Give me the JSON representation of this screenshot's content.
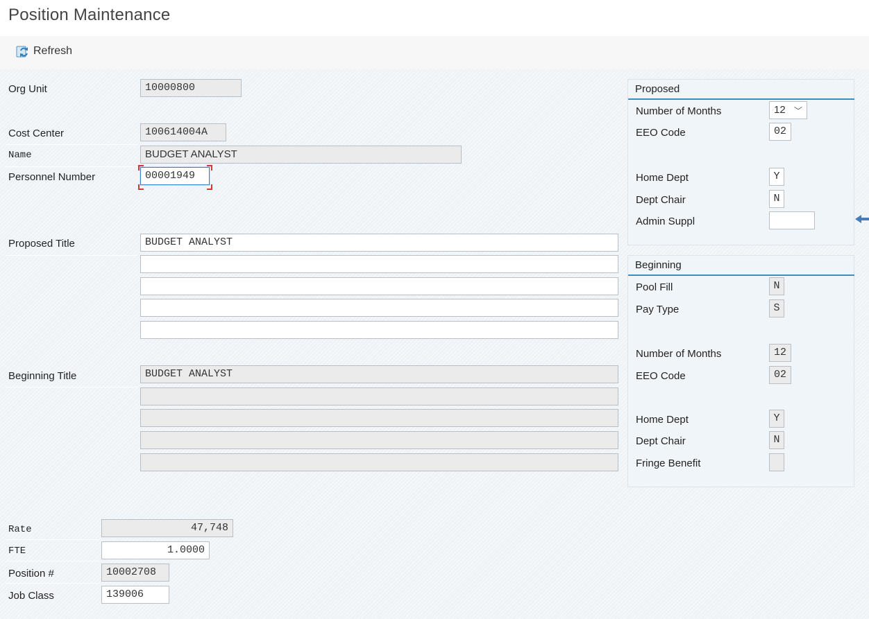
{
  "app": {
    "title": "Position Maintenance"
  },
  "toolbar": {
    "refresh_label": "Refresh",
    "refresh_icon": "refresh-icon"
  },
  "left": {
    "org_unit_label": "Org Unit",
    "org_unit_value": "10000800",
    "cost_center_label": "Cost Center",
    "cost_center_value": "100614004A",
    "name_label": "Name",
    "name_value": "BUDGET ANALYST",
    "personnel_label": "Personnel Number",
    "personnel_value": "00001949",
    "proposed_title_label": "Proposed Title",
    "proposed_title_lines": [
      "BUDGET ANALYST",
      "",
      "",
      "",
      ""
    ],
    "beginning_title_label": "Beginning Title",
    "beginning_title_lines": [
      "BUDGET ANALYST",
      "",
      "",
      "",
      ""
    ],
    "rate_label": "Rate",
    "rate_value": "47,748",
    "fte_label": "FTE",
    "fte_value": "1.0000",
    "position_label": "Position #",
    "position_value": "10002708",
    "job_class_label": "Job Class",
    "job_class_value": "139006"
  },
  "proposed": {
    "header": "Proposed",
    "months_label": "Number of Months",
    "months_value": "12",
    "eeo_label": "EEO Code",
    "eeo_value": "02",
    "home_dept_label": "Home Dept",
    "home_dept_value": "Y",
    "dept_chair_label": "Dept Chair",
    "dept_chair_value": "N",
    "admin_suppl_label": "Admin Suppl",
    "admin_suppl_value": ""
  },
  "beginning": {
    "header": "Beginning",
    "pool_fill_label": "Pool Fill",
    "pool_fill_value": "N",
    "pay_type_label": "Pay Type",
    "pay_type_value": "S",
    "months_label": "Number of Months",
    "months_value": "12",
    "eeo_label": "EEO Code",
    "eeo_value": "02",
    "home_dept_label": "Home Dept",
    "home_dept_value": "Y",
    "dept_chair_label": "Dept Chair",
    "dept_chair_value": "N",
    "fringe_label": "Fringe Benefit",
    "fringe_value": ""
  },
  "colors": {
    "accent": "#3a8cc4",
    "focus_marker": "#d0383f",
    "background": "#eef3f7"
  }
}
